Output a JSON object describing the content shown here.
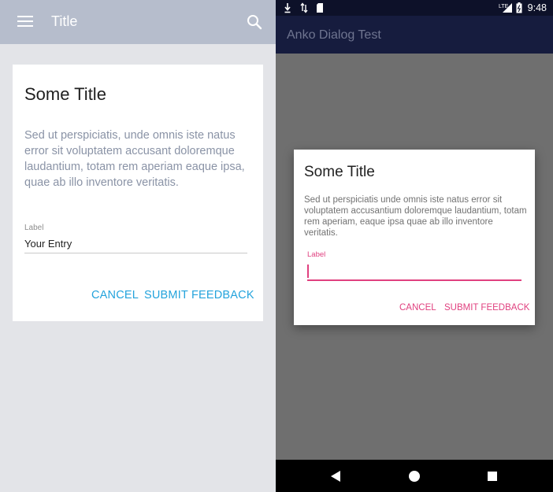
{
  "left": {
    "appbar": {
      "title": "Title",
      "menu_icon": "menu-icon",
      "search_icon": "search-icon"
    },
    "dialog": {
      "title": "Some Title",
      "body": "Sed ut perspiciatis, unde omnis iste natus error sit voluptatem accusant doloremque laudantium, totam rem aperiam eaque ipsa, quae ab illo inventore veritatis.",
      "field": {
        "label": "Label",
        "value": "Your Entry"
      },
      "cancel_label": "CANCEL",
      "submit_label": "SUBMIT FEEDBACK"
    },
    "colors": {
      "appbar": "#b6bdcc",
      "accent": "#23a3dc",
      "background": "#e3e4e8"
    }
  },
  "right": {
    "status_bar": {
      "time": "9:48",
      "network": "LTE",
      "icons": [
        "download-icon",
        "data-transfer-icon",
        "sd-card-icon",
        "signal-icon",
        "battery-icon"
      ]
    },
    "action_bar": {
      "title": "Anko Dialog Test"
    },
    "dialog": {
      "title": "Some Title",
      "body": "Sed ut perspiciatis unde omnis iste natus error sit voluptatem accusantium doloremque laudantium, totam rem aperiam, eaque ipsa quae ab illo inventore veritatis.",
      "field": {
        "label": "Label",
        "value": ""
      },
      "cancel_label": "CANCEL",
      "submit_label": "SUBMIT FEEDBACK"
    },
    "nav_bar": {
      "icons": [
        "back-icon",
        "home-icon",
        "recents-icon"
      ]
    },
    "colors": {
      "status_bar": "#0d1129",
      "action_bar": "#161c3e",
      "accent": "#e0407f",
      "scrim": "#6f6f6f"
    }
  }
}
